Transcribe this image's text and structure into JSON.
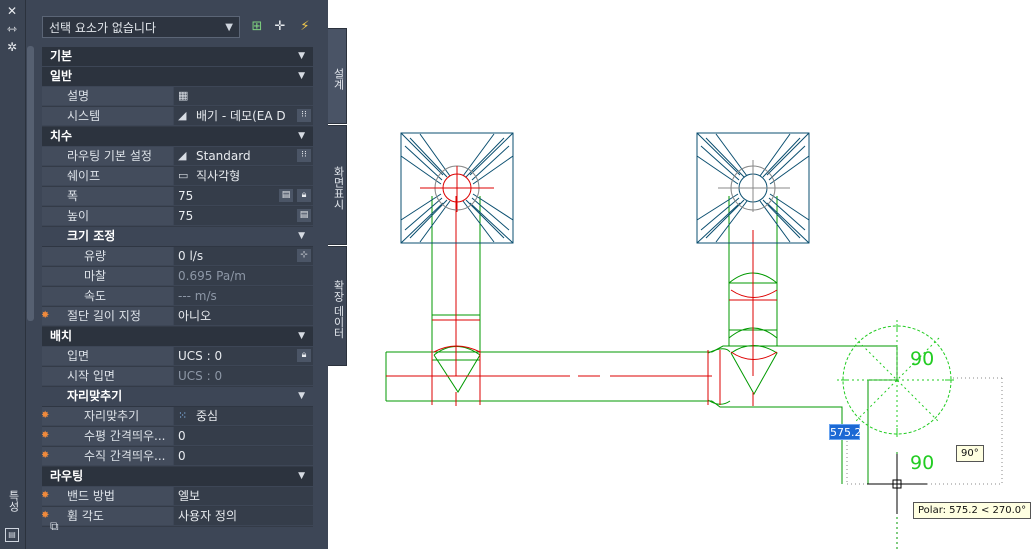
{
  "palette": {
    "strip_title": "특성",
    "selection_dropdown": "선택 요소가 없습니다",
    "categories": [
      {
        "key": "basic",
        "label": "기본"
      },
      {
        "key": "general",
        "label": "일반"
      },
      {
        "key": "dimensions",
        "label": "치수"
      },
      {
        "key": "layout",
        "label": "배치"
      },
      {
        "key": "routing",
        "label": "라우팅"
      }
    ],
    "general": {
      "description_label": "설명",
      "system_label": "시스템",
      "system_value": "배기 - 데모(EA D"
    },
    "dimensions": {
      "routing_pref_label": "라우팅 기본 설정",
      "routing_pref_value": "Standard",
      "shape_label": "쉐이프",
      "shape_value": "직사각형",
      "width_label": "폭",
      "width_value": "75",
      "height_label": "높이",
      "height_value": "75",
      "sizing_label": "크기 조정",
      "flow_label": "유량",
      "flow_value": "0 l/s",
      "friction_label": "마찰",
      "friction_value": "0.695 Pa/m",
      "velocity_label": "속도",
      "velocity_value": "--- m/s",
      "cut_length_label": "절단 길이 지정",
      "cut_length_value": "아니오"
    },
    "layout": {
      "elevation_label": "입면",
      "elevation_value": "UCS : 0",
      "start_elevation_label": "시작 입면",
      "start_elevation_value": "UCS : 0",
      "justification_group": "자리맞추기",
      "justify_label": "자리맞추기",
      "justify_value": "중심",
      "h_offset_label": "수평 간격띄우...",
      "h_offset_value": "0",
      "v_offset_label": "수직 간격띄우...",
      "v_offset_value": "0"
    },
    "routing": {
      "bend_label": "밴드 방법",
      "bend_value": "엘보",
      "bend_angle_label": "휨 각도",
      "bend_angle_value": "사용자 정의"
    },
    "tabs": [
      "설계",
      "화면표시",
      "확장 데이터"
    ]
  },
  "drawing": {
    "colors": {
      "duct": "#009900",
      "centerline": "#dd0000",
      "diffuser": "#0b4f70",
      "compass": "#22cc22",
      "cursor": "#000000"
    },
    "compass_labels": [
      "90",
      "90"
    ],
    "dim_input": "575.2",
    "angle_tooltip": "90°",
    "polar_tooltip": "Polar: 575.2 < 270.0°"
  }
}
